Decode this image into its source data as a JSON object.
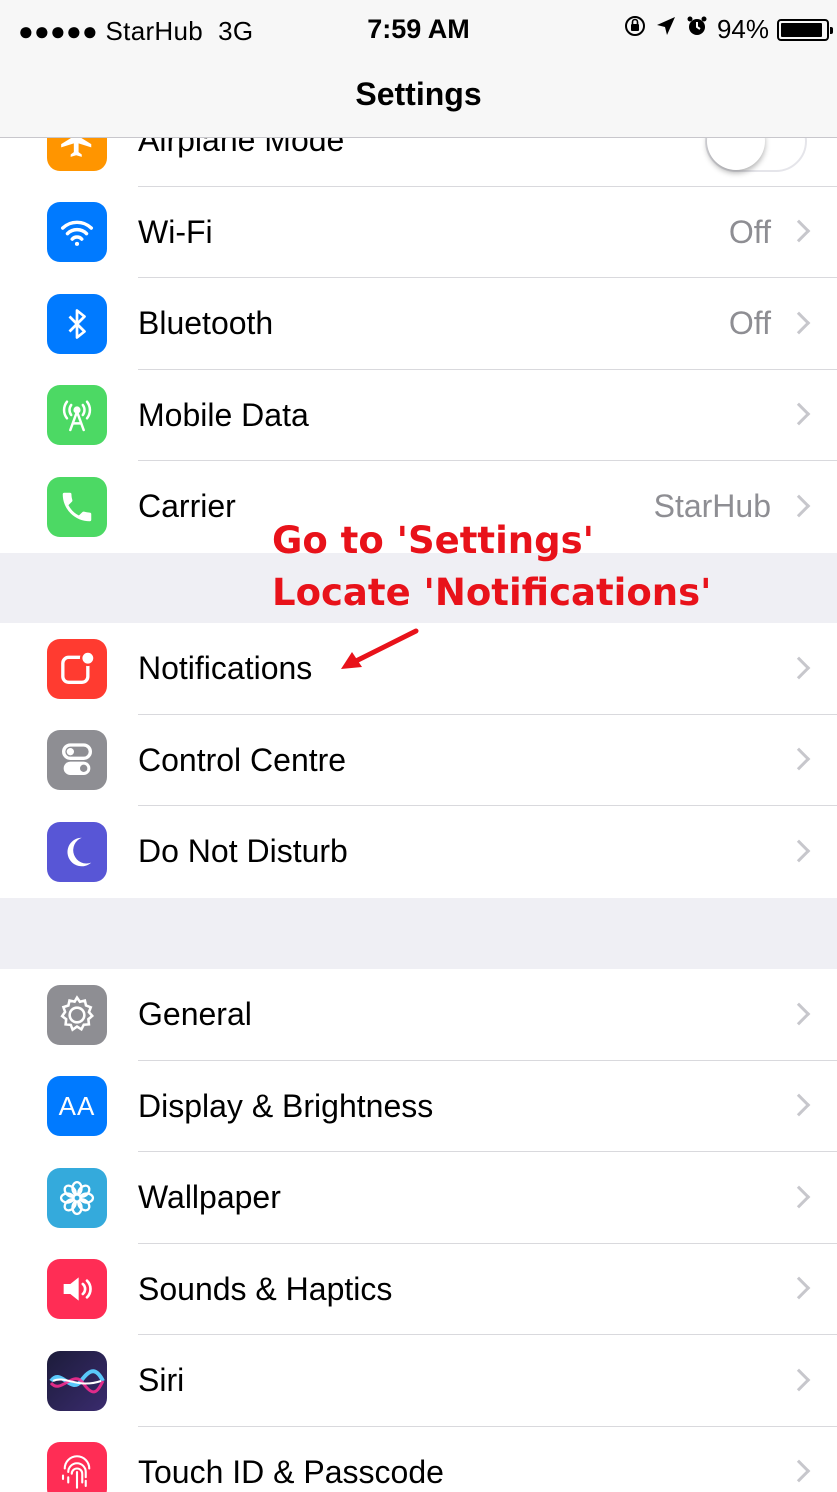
{
  "status_bar": {
    "signal": "●●●●● StarHub",
    "network": "3G",
    "time": "7:59 AM",
    "battery_percent": "94%",
    "battery_level": 0.94
  },
  "nav": {
    "title": "Settings"
  },
  "rows": {
    "airplane": {
      "label": "Airplane Mode",
      "toggle_on": false,
      "icon": "airplane-icon",
      "color": "#ff9500"
    },
    "wifi": {
      "label": "Wi-Fi",
      "detail": "Off",
      "icon": "wifi-icon",
      "color": "#007aff"
    },
    "bluetooth": {
      "label": "Bluetooth",
      "detail": "Off",
      "icon": "bluetooth-icon",
      "color": "#007aff"
    },
    "mobile_data": {
      "label": "Mobile Data",
      "icon": "antenna-icon",
      "color": "#4cd964"
    },
    "carrier": {
      "label": "Carrier",
      "detail": "StarHub",
      "icon": "phone-icon",
      "color": "#4cd964"
    },
    "notifications": {
      "label": "Notifications",
      "icon": "notifications-icon",
      "color": "#ff3b30"
    },
    "control_centre": {
      "label": "Control Centre",
      "icon": "switches-icon",
      "color": "#8e8e93"
    },
    "dnd": {
      "label": "Do Not Disturb",
      "icon": "moon-icon",
      "color": "#5856d6"
    },
    "general": {
      "label": "General",
      "icon": "gear-icon",
      "color": "#8e8e93"
    },
    "display": {
      "label": "Display & Brightness",
      "icon_text": "AA",
      "icon": "text-size-icon",
      "color": "#007aff"
    },
    "wallpaper": {
      "label": "Wallpaper",
      "icon": "flower-icon",
      "color": "#34aadc"
    },
    "sounds": {
      "label": "Sounds & Haptics",
      "icon": "speaker-icon",
      "color": "#ff2d55"
    },
    "siri": {
      "label": "Siri",
      "icon": "siri-icon",
      "color": "#1c1c3a"
    },
    "touch_id": {
      "label": "Touch ID & Passcode",
      "icon": "fingerprint-icon",
      "color": "#ff2d55"
    }
  },
  "annotation": {
    "line1": "Go to 'Settings'",
    "line2": "Locate 'Notifications'",
    "color": "#e8121a"
  }
}
